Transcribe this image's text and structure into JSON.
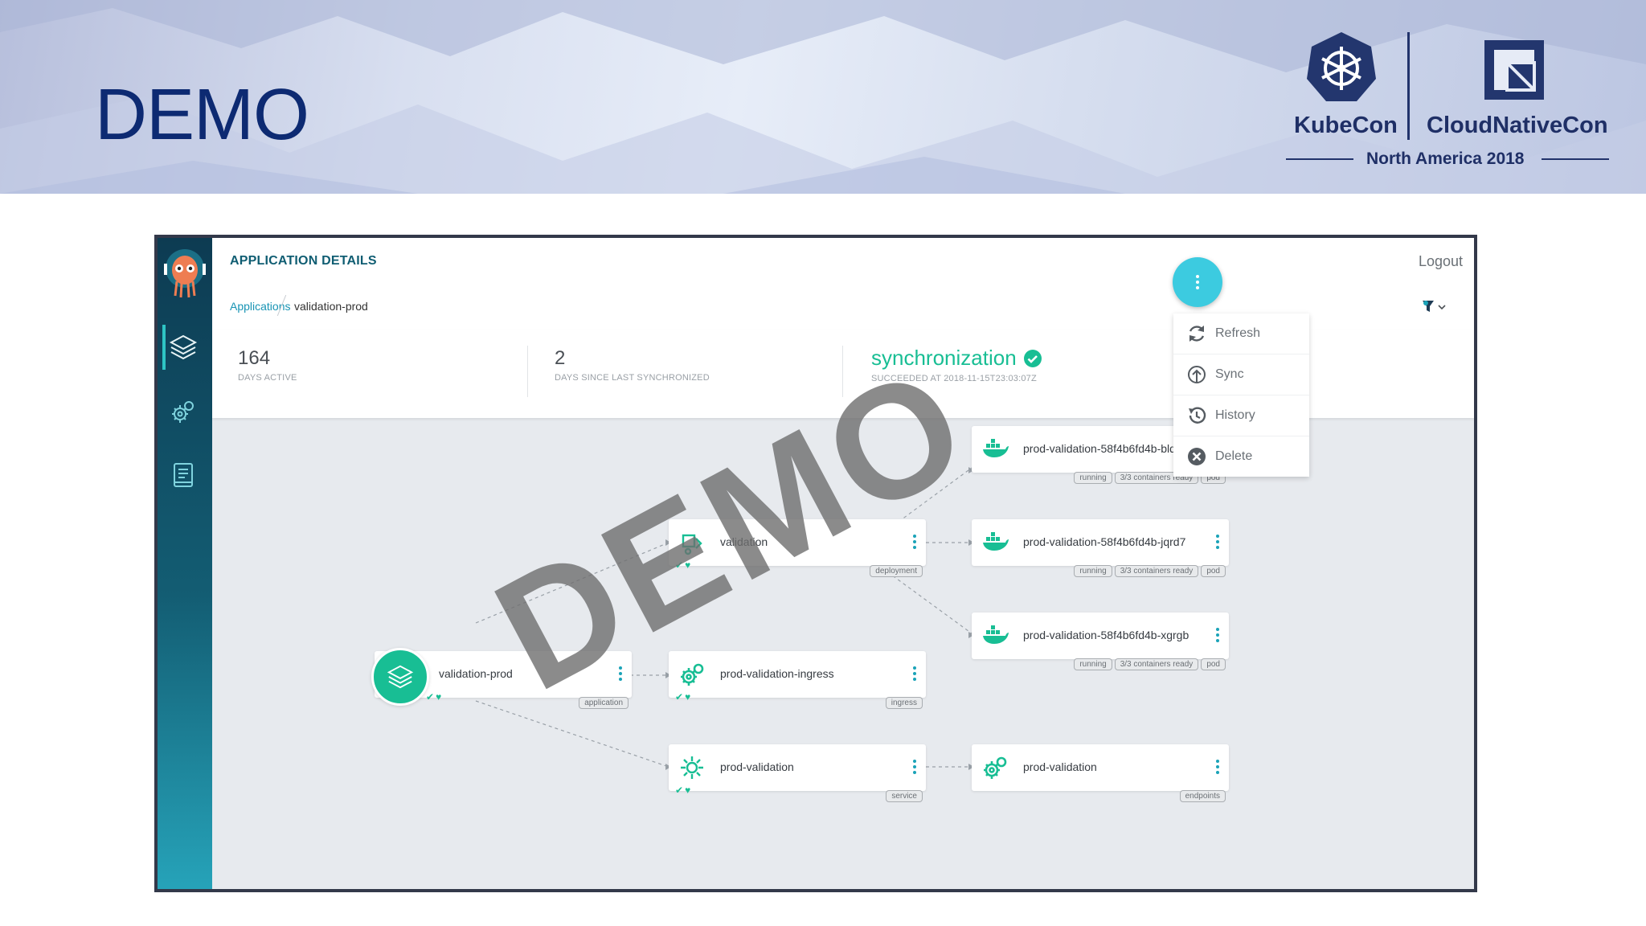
{
  "slide": {
    "title": "DEMO",
    "watermark": "DEMO",
    "brand": {
      "kubecon": "KubeCon",
      "cncf": "CloudNativeCon",
      "region": "North America 2018"
    }
  },
  "app": {
    "title": "APPLICATION DETAILS",
    "logout": "Logout",
    "breadcrumb": {
      "link": "Applications",
      "current": "validation-prod"
    },
    "stats": [
      {
        "value": "164",
        "caption": "DAYS ACTIVE"
      },
      {
        "value": "2",
        "caption": "DAYS SINCE LAST SYNCHRONIZED"
      }
    ],
    "sync": {
      "title": "synchronization",
      "caption": "SUCCEEDED AT 2018-11-15T23:03:07Z"
    }
  },
  "action_menu": {
    "items": [
      {
        "label": "Refresh",
        "icon": "refresh-icon"
      },
      {
        "label": "Sync",
        "icon": "sync-icon"
      },
      {
        "label": "History",
        "icon": "history-icon"
      },
      {
        "label": "Delete",
        "icon": "delete-icon"
      }
    ]
  },
  "nodes": {
    "app": {
      "label": "validation-prod",
      "tags": [
        "application"
      ],
      "icon": "layers-icon"
    },
    "deployment": {
      "label": "validation",
      "tags": [
        "deployment"
      ],
      "icon": "deployment-icon"
    },
    "ingress": {
      "label": "prod-validation-ingress",
      "tags": [
        "ingress"
      ],
      "icon": "gears-icon"
    },
    "service": {
      "label": "prod-validation",
      "tags": [
        "service"
      ],
      "icon": "service-icon"
    },
    "pod1": {
      "label": "prod-validation-58f4b6fd4b-bldtv",
      "tags": [
        "running",
        "3/3 containers ready",
        "pod"
      ],
      "icon": "docker-icon"
    },
    "pod2": {
      "label": "prod-validation-58f4b6fd4b-jqrd7",
      "tags": [
        "running",
        "3/3 containers ready",
        "pod"
      ],
      "icon": "docker-icon"
    },
    "pod3": {
      "label": "prod-validation-58f4b6fd4b-xgrgb",
      "tags": [
        "running",
        "3/3 containers ready",
        "pod"
      ],
      "icon": "docker-icon"
    },
    "endpoints": {
      "label": "prod-validation",
      "tags": [
        "endpoints"
      ],
      "icon": "gears-icon"
    }
  },
  "colors": {
    "accent": "#18be94",
    "link": "#1894b4",
    "fab": "#3ccbe0",
    "title": "#0d2a72"
  }
}
